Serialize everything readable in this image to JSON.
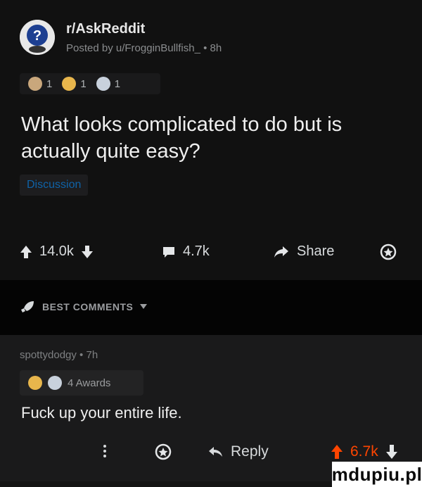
{
  "post": {
    "subreddit": "r/AskReddit",
    "posted_by": "Posted by u/FrogginBullfish_ • 8h",
    "awards": [
      {
        "icon": "wholesome-award-icon",
        "count": "1"
      },
      {
        "icon": "helpful-award-icon",
        "count": "1"
      },
      {
        "icon": "silver-award-icon",
        "count": "1"
      }
    ],
    "title": "What looks complicated to do but is actually quite easy?",
    "flair": "Discussion",
    "votes": "14.0k",
    "comments": "4.7k",
    "share": "Share"
  },
  "comments_header": {
    "label": "BEST COMMENTS"
  },
  "comment": {
    "author": "spottydodgy • 7h",
    "awards_label": "4 Awards",
    "text": "Fuck up your entire life.",
    "reply": "Reply",
    "votes": "6.7k"
  },
  "watermark": "mdupiu.pl",
  "colors": {
    "upvote": "#e4e6e8",
    "flair_text": "#0f63a8",
    "accent": "#ff4500"
  }
}
